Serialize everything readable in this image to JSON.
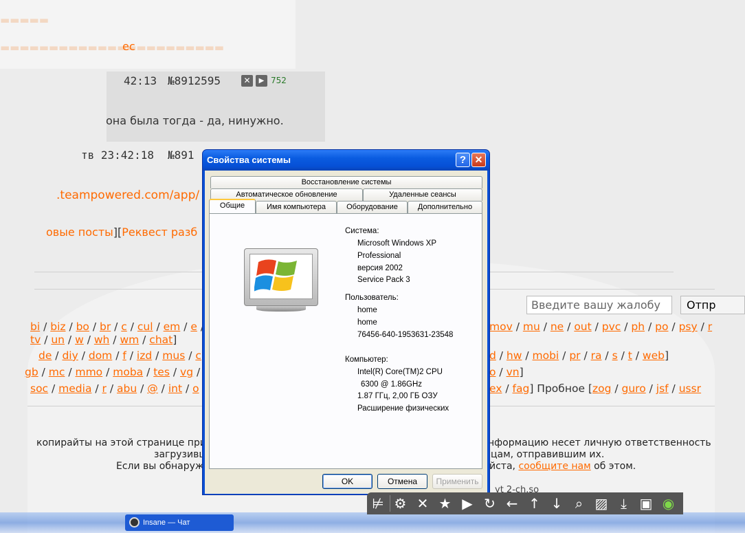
{
  "background": {
    "post1_time": "42:13",
    "post1_num": "№8912595",
    "post1_replies": "752",
    "post1_text": "она была тогда - да, нинужно.",
    "post2_time": "тв 23:42:18",
    "post2_num": "№891",
    "link_text": "teampowered.com/app/",
    "link_prefix": ".",
    "blur_link": "ec",
    "nav_labels": {
      "posts": "овые посты",
      "bracket_open": "][",
      "request": "Реквест разб"
    },
    "complaint_placeholder": "Введите вашу жалобу",
    "send_label": "Отпр",
    "nav_row1": [
      "bi",
      "biz",
      "bo",
      "br",
      "c",
      "cul",
      "em",
      "e"
    ],
    "nav_row1_right": [
      "mov",
      "mu",
      "ne",
      "out",
      "pvc",
      "ph",
      "po",
      "psy",
      "r"
    ],
    "nav_row2": [
      "tv",
      "un",
      "w",
      "wh",
      "wm",
      "chat"
    ],
    "nav_row3": [
      "de",
      "diy",
      "dom",
      "f",
      "izd",
      "mus",
      "c"
    ],
    "nav_row3_right": [
      "d",
      "hw",
      "mobi",
      "pr",
      "ra",
      "s",
      "t",
      "web"
    ],
    "nav_row4": [
      "gb",
      "mc",
      "mmo",
      "moba",
      "tes",
      "vg"
    ],
    "nav_row4_right": [
      "o",
      "vn"
    ],
    "nav_row5": [
      "soc",
      "media",
      "r",
      "abu",
      "@",
      "int",
      "o"
    ],
    "nav_row5_right": [
      "ex",
      "fag"
    ],
    "trial_label": "Пробное",
    "trial_items": [
      "zog",
      "guro",
      "jsf",
      "ussr"
    ],
    "footer_line1_left": "копирайты на этой странице при",
    "footer_line1_right": "нформацию несет личную ответственность",
    "footer_line2_left": "загрузивш",
    "footer_line2_right": "цам, отправившим их.",
    "footer_line3_left": "Если вы обнаруж",
    "footer_line3_mid": "йста,",
    "footer_line3_link": "сообщите нам",
    "footer_line3_end": "об этом.",
    "bottom_fragment": "yt 2-ch.so"
  },
  "dialog": {
    "title": "Свойства системы",
    "help_btn": "?",
    "close_btn": "✕",
    "tabs_row1": [
      "Восстановление системы"
    ],
    "tabs_row2": [
      "Автоматическое обновление",
      "Удаленные сеансы"
    ],
    "tabs_row3": [
      "Общие",
      "Имя компьютера",
      "Оборудование",
      "Дополнительно"
    ],
    "system_label": "Система:",
    "system_lines": [
      "Microsoft Windows XP",
      "Professional",
      "версия 2002",
      "Service Pack 3"
    ],
    "user_label": "Пользователь:",
    "user_lines": [
      "home",
      "home",
      "76456-640-1953631-23548"
    ],
    "computer_label": "Компьютер:",
    "computer_lines": [
      "Intel(R) Core(TM)2 CPU",
      "6300  @ 1.86GHz",
      "1.87 ГГц, 2,00 ГБ ОЗУ",
      "Расширение физических"
    ],
    "ok": "OK",
    "cancel": "Отмена",
    "apply": "Применить"
  },
  "taskbar": {
    "window_label": "Insane — Чат"
  },
  "viewer_toolbar": {
    "icons": [
      "crop-icon",
      "settings-icon",
      "close-icon",
      "star-icon",
      "play-icon",
      "rotate-icon",
      "arrow-left-icon",
      "arrow-up-icon",
      "arrow-down-icon",
      "zoom-icon",
      "hatch-icon",
      "download-icon",
      "save-icon",
      "eye-icon"
    ]
  }
}
